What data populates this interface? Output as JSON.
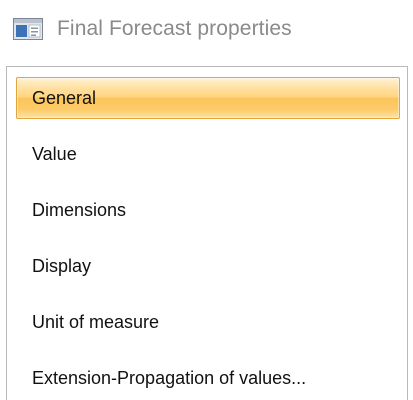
{
  "window": {
    "title": "Final Forecast properties",
    "icon": "properties-window-icon"
  },
  "nav": {
    "selected_index": 0,
    "items": [
      {
        "label": "General"
      },
      {
        "label": "Value"
      },
      {
        "label": "Dimensions"
      },
      {
        "label": "Display"
      },
      {
        "label": "Unit of measure"
      },
      {
        "label": "Extension-Propagation of values..."
      }
    ]
  },
  "colors": {
    "title_text": "#8a8a8a",
    "panel_border": "#b9b9b9",
    "selection_border": "#e2a23c",
    "selection_fill": "#ffd47e"
  }
}
